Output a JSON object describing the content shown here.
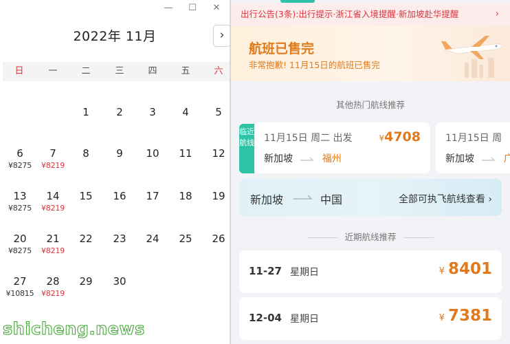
{
  "calendar": {
    "window_controls": [
      "—",
      "☐",
      "✕"
    ],
    "title": "2022年 11月",
    "next_label": "›",
    "weekdays": [
      "日",
      "一",
      "二",
      "三",
      "四",
      "五",
      "六"
    ],
    "weeks": [
      [
        {
          "d": ""
        },
        {
          "d": ""
        },
        {
          "d": "1"
        },
        {
          "d": "2"
        },
        {
          "d": "3"
        },
        {
          "d": "4"
        },
        {
          "d": "5"
        }
      ],
      [
        {
          "d": "6",
          "p": "¥8275"
        },
        {
          "d": "7",
          "p": "¥8219",
          "red": true
        },
        {
          "d": "8"
        },
        {
          "d": "9"
        },
        {
          "d": "10"
        },
        {
          "d": "11"
        },
        {
          "d": "12"
        }
      ],
      [
        {
          "d": "13",
          "p": "¥8275"
        },
        {
          "d": "14",
          "p": "¥8219",
          "red": true
        },
        {
          "d": "15"
        },
        {
          "d": "16"
        },
        {
          "d": "17"
        },
        {
          "d": "18"
        },
        {
          "d": "19"
        }
      ],
      [
        {
          "d": "20",
          "p": "¥8275"
        },
        {
          "d": "21",
          "p": "¥8219",
          "red": true
        },
        {
          "d": "22"
        },
        {
          "d": "23"
        },
        {
          "d": "24"
        },
        {
          "d": "25"
        },
        {
          "d": "26"
        }
      ],
      [
        {
          "d": "27",
          "p": "¥10815"
        },
        {
          "d": "28",
          "p": "¥8219",
          "red": true
        },
        {
          "d": "29"
        },
        {
          "d": "30"
        },
        {
          "d": ""
        },
        {
          "d": ""
        },
        {
          "d": ""
        }
      ]
    ],
    "watermark": "shicheng.news",
    "colors": {
      "red": "#d9363e",
      "header_bg": "#f4f4f4"
    }
  },
  "app": {
    "notice": "出行公告(3条):出行提示·浙江省入境提醒·新加坡赴华提醒",
    "notice_chevron": "›",
    "soldout": {
      "title": "航班已售完",
      "subtitle": "非常抱歉! 11月15日的航班已售完"
    },
    "hot_routes_label": "其他热门航线推荐",
    "near_tag": "临近航线",
    "route_cards": [
      {
        "date": "11月15日 周二 出发",
        "currency": "¥",
        "price": "4708",
        "from": "新加坡",
        "to": "福州"
      },
      {
        "date": "11月15日 周",
        "currency": "",
        "price": "",
        "from": "新加坡",
        "to": "广"
      }
    ],
    "china_card": {
      "from": "新加坡",
      "to": "中国",
      "link": "全部可执飞航线查看 ›"
    },
    "recent_label": "近期航线推荐",
    "date_cards": [
      {
        "date": "11-27",
        "weekday": "星期日",
        "currency": "¥",
        "price": "8401"
      },
      {
        "date": "12-04",
        "weekday": "星期日",
        "currency": "¥",
        "price": "7381"
      }
    ],
    "colors": {
      "accent_orange": "#e07a1c",
      "teal": "#2dc3a6",
      "notice_red": "#d9363e"
    }
  }
}
